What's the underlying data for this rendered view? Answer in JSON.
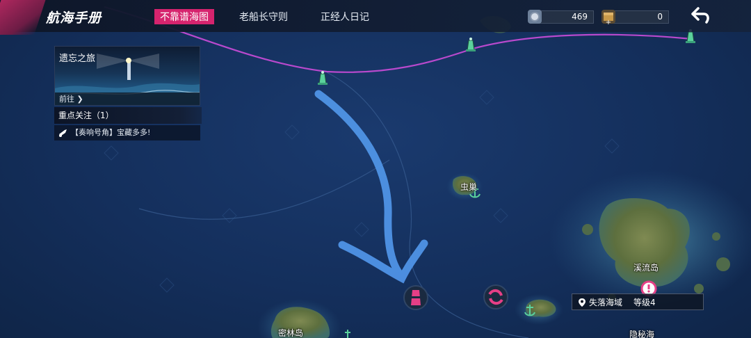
{
  "header": {
    "title": "航海手册",
    "tabs": [
      {
        "label": "不靠谱海图",
        "active": true
      },
      {
        "label": "老船长守则",
        "active": false
      },
      {
        "label": "正经人日记",
        "active": false
      }
    ],
    "resources": [
      {
        "icon": "silver-coin-icon",
        "value": "469"
      },
      {
        "icon": "treasure-chest-icon",
        "value": "0"
      }
    ],
    "back_icon": "return-arrow-icon"
  },
  "quest_panel": {
    "card_title": "遗忘之旅",
    "card_action": "前往",
    "focus_title": "重点关注（1）",
    "task": {
      "tag": "【奏响号角】",
      "text": "宝藏多多!"
    }
  },
  "map": {
    "labels": {
      "insect_nest": "虫巢",
      "stream_island": "溪流岛",
      "dense_forest_island": "密林岛",
      "hidden_sea": "隐秘海"
    },
    "region_info": {
      "name": "失落海域",
      "level_label": "等级4"
    },
    "colors": {
      "route": "#c24bd3",
      "annotation_arrow": "#4f93e6",
      "buoy": "#5bd19c",
      "marker": "#e53f86",
      "accent": "#d6246e"
    }
  }
}
